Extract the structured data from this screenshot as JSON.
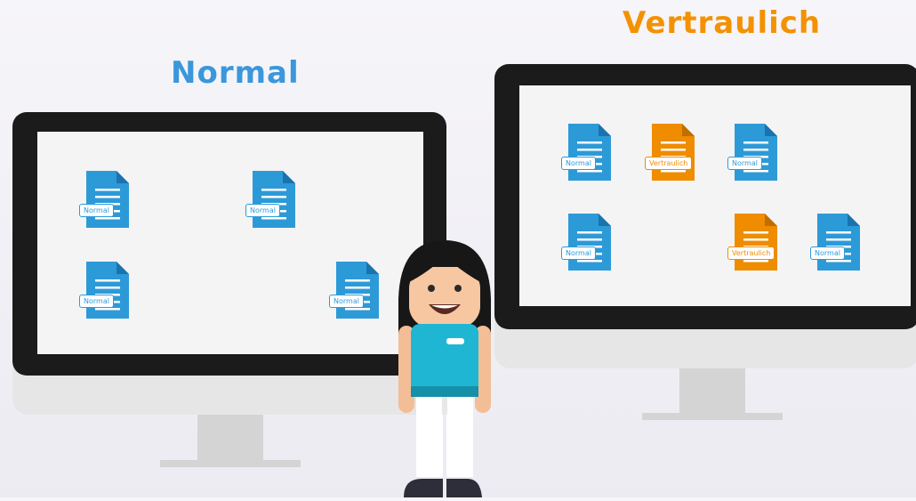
{
  "headings": {
    "normal": "Normal",
    "confidential": "Vertraulich"
  },
  "colors": {
    "normal_accent": "#3b97dc",
    "confidential_accent": "#f39200",
    "doc_blue": "#2d9ad8",
    "doc_orange": "#ef8c00"
  },
  "left_monitor": {
    "documents": [
      {
        "label": "Normal",
        "kind": "normal"
      },
      {
        "label": "Normal",
        "kind": "normal"
      },
      {
        "label": "Normal",
        "kind": "normal"
      },
      {
        "label": "Normal",
        "kind": "normal"
      }
    ]
  },
  "right_monitor": {
    "documents": [
      {
        "label": "Normal",
        "kind": "normal"
      },
      {
        "label": "Vertraulich",
        "kind": "confidential"
      },
      {
        "label": "Normal",
        "kind": "normal"
      },
      {
        "label": "Normal",
        "kind": "normal"
      },
      {
        "label": "Vertraulich",
        "kind": "confidential"
      },
      {
        "label": "Normal",
        "kind": "normal"
      }
    ]
  },
  "icons": [
    "document-icon",
    "person-illustration"
  ]
}
